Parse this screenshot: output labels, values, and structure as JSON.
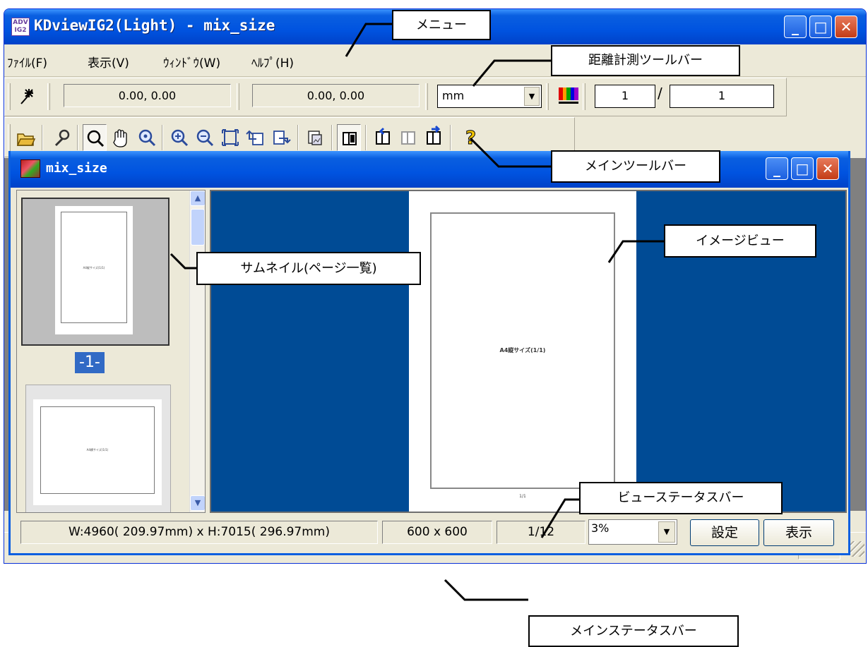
{
  "window": {
    "app_icon_text": "ADV IG2",
    "title": "KDviewIG2(Light) - mix_size",
    "minimize": "_",
    "maximize": "□",
    "close": "✕"
  },
  "menu": {
    "file": "ﾌｧｲﾙ(F)",
    "view": "表示(V)",
    "window": "ｳｨﾝﾄﾞｳ(W)",
    "help": "ﾍﾙﾌﾟ(H)"
  },
  "measure_toolbar": {
    "tool_icon": "measure-icon",
    "coord1": "0.00, 0.00",
    "coord2": "0.00, 0.00",
    "unit": "mm",
    "page_current": "1",
    "page_separator": "/",
    "page_total": "1"
  },
  "main_toolbar": {
    "icons": [
      "open-folder-icon",
      "wrench-icon",
      "zoom-select-icon",
      "hand-pan-icon",
      "zoom-area-icon",
      "zoom-in-icon",
      "zoom-out-icon",
      "fit-page-icon",
      "rotate-left-icon",
      "rotate-right-icon",
      "copy-image-icon",
      "book-icon",
      "prev-page-icon",
      "page-disabled-icon",
      "next-page-icon",
      "help-icon"
    ]
  },
  "child_window": {
    "title": "mix_size"
  },
  "thumbnails": {
    "page1_text": "A4縦サイズ(1/1)",
    "page1_label": "-1-",
    "page2_text": "A4横サイズ(1/1)"
  },
  "image_view": {
    "page_text": "A4縦サイズ(1/1)",
    "page_number": "1/1"
  },
  "view_statusbar": {
    "size": "W:4960( 209.97mm) x H:7015( 296.97mm)",
    "dpi": "600 x 600",
    "page": "1/12",
    "zoom": "3%",
    "settings_button": "設定",
    "display_button": "表示"
  },
  "callouts": {
    "menu": "メニュー",
    "measure_toolbar": "距離計測ツールバー",
    "main_toolbar": "メインツールバー",
    "image_view": "イメージビュー",
    "thumbnail": "サムネイル(ページ一覧)",
    "view_statusbar": "ビューステータスバー",
    "main_statusbar": "メインステータスバー"
  }
}
